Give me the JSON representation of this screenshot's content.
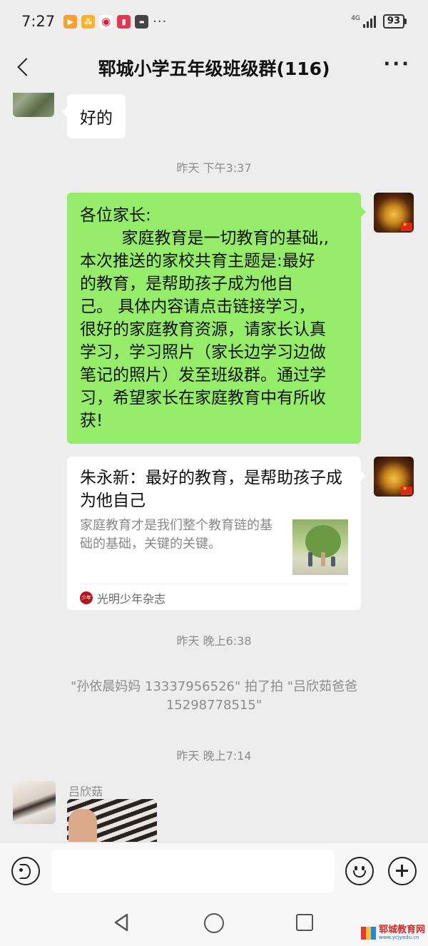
{
  "status_bar": {
    "time": "7:27",
    "network": "4G",
    "battery": "93",
    "more_indicator": "···",
    "app_icons": [
      {
        "name": "video-app-icon",
        "color": "#f6a02d"
      },
      {
        "name": "news-app-icon",
        "color": "#ffb226"
      },
      {
        "name": "weibo-icon",
        "color": "#e6162d"
      },
      {
        "name": "book-app-icon",
        "color": "#e8344e"
      },
      {
        "name": "huawei-store-icon",
        "color": "#444444"
      }
    ]
  },
  "nav": {
    "title": "郓城小学五年级班级群(116)",
    "more": "···"
  },
  "messages": {
    "reply_ok": "好的",
    "time_1": "昨天 下午3:37",
    "announcement": [
      "各位家长:",
      "        家庭教育是一切教育的基础,,",
      "本次推送的家校共育主题是:最好",
      "的教育，是帮助孩子成为他自",
      "己。 具体内容请点击链接学习，",
      "很好的家庭教育资源，请家长认真",
      "学习，学习照片（家长边学习边做",
      "笔记的照片）发至班级群。通过学",
      "习，希望家长在家庭教育中有所收",
      "获!"
    ],
    "card": {
      "title": "朱永新：最好的教育，是帮助孩子成为他自己",
      "description": "家庭教育才是我们整个教育链的基础的基础，关键的关键。",
      "source": "光明少年杂志",
      "source_icon_text": "少年"
    },
    "time_2": "昨天 晚上6:38",
    "system_notice": "\"孙依晨妈妈 13337956526\" 拍了拍 \"吕欣茹爸爸 15298778515\"",
    "time_3": "昨天 晚上7:14",
    "sender_name": "吕欣菇"
  },
  "input_bar": {
    "placeholder": ""
  },
  "watermark": {
    "text": "郓城教育网",
    "url": "www.ycjyedu.cn"
  },
  "colors": {
    "own_bubble": "#95ec69",
    "background": "#ededed"
  }
}
